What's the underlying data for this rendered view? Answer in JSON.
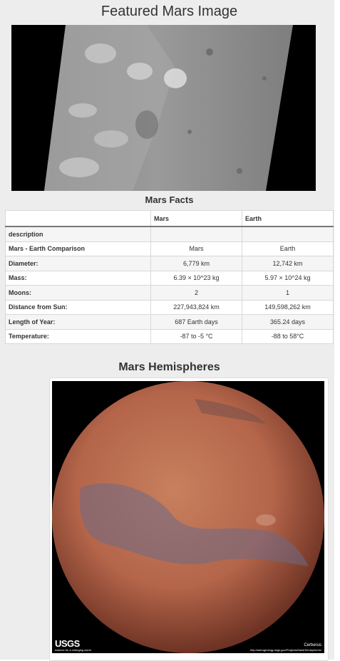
{
  "featured": {
    "title": "Featured Mars Image"
  },
  "facts": {
    "title": "Mars Facts",
    "columns": [
      "",
      "Mars",
      "Earth"
    ],
    "rows": [
      {
        "label": "description",
        "mars": "",
        "earth": ""
      },
      {
        "label": "Mars - Earth Comparison",
        "mars": "Mars",
        "earth": "Earth"
      },
      {
        "label": "Diameter:",
        "mars": "6,779 km",
        "earth": "12,742 km"
      },
      {
        "label": "Mass:",
        "mars": "6.39 × 10^23 kg",
        "earth": "5.97 × 10^24 kg"
      },
      {
        "label": "Moons:",
        "mars": "2",
        "earth": "1"
      },
      {
        "label": "Distance from Sun:",
        "mars": "227,943,824 km",
        "earth": "149,598,262 km"
      },
      {
        "label": "Length of Year:",
        "mars": "687 Earth days",
        "earth": "365.24 days"
      },
      {
        "label": "Temperature:",
        "mars": "-87 to -5 °C",
        "earth": "-88 to 58°C"
      }
    ]
  },
  "hemispheres": {
    "title": "Mars Hemispheres",
    "image": {
      "logo_text": "USGS",
      "logo_subtitle": "science for a changing world",
      "credit_name": "Cerberus",
      "credit_url": "http://astrogeology.usgs.gov/Projects/MarsHemispheres/"
    }
  }
}
